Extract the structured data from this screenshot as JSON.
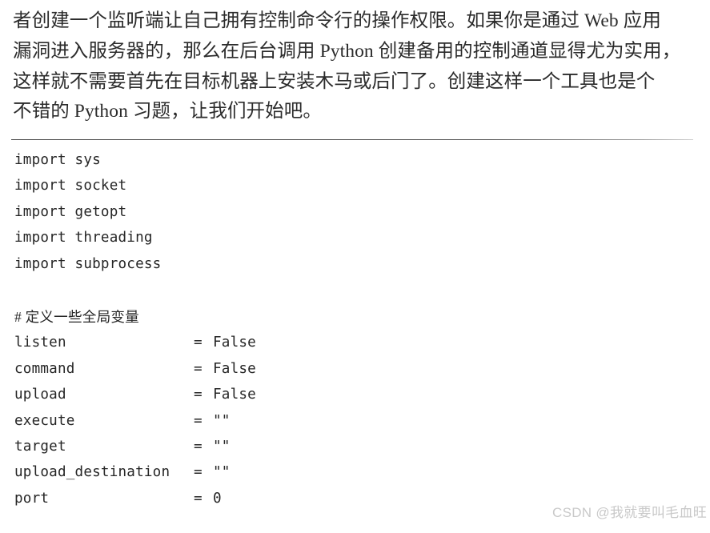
{
  "page": {
    "background_color": "#ffffff",
    "text_color": "#2b2b2b",
    "code_color": "#262626"
  },
  "prose": {
    "lines": [
      "者创建一个监听端让自己拥有控制命令行的操作权限。如果你是通过 Web 应用",
      "漏洞进入服务器的，那么在后台调用 Python 创建备用的控制通道显得尤为实用，",
      "这样就不需要首先在目标机器上安装木马或后门了。创建这样一个工具也是个",
      "不错的 Python 习题，让我们开始吧。"
    ]
  },
  "divider": {
    "color": "#4a4a4a"
  },
  "code": {
    "imports": [
      "import sys",
      "import socket",
      "import getopt",
      "import threading",
      "import subprocess"
    ],
    "comment": "# 定义一些全局变量",
    "assignments": [
      {
        "name": "listen",
        "operator": "=",
        "value": "False"
      },
      {
        "name": "command",
        "operator": "=",
        "value": "False"
      },
      {
        "name": "upload",
        "operator": "=",
        "value": "False"
      },
      {
        "name": "execute",
        "operator": "=",
        "value": "\"\""
      },
      {
        "name": "target",
        "operator": "=",
        "value": "\"\""
      },
      {
        "name": "upload_destination",
        "operator": "=",
        "value": "\"\""
      },
      {
        "name": "port",
        "operator": "=",
        "value": "0"
      }
    ]
  },
  "watermark": {
    "text": "CSDN @我就要叫毛血旺",
    "color": "#c9c9c9"
  }
}
